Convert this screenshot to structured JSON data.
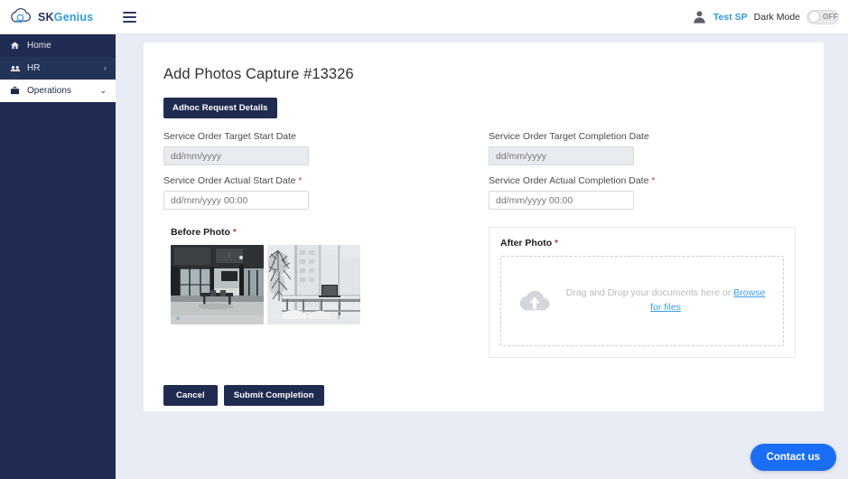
{
  "brand": {
    "sk": "SK",
    "genius": "Genius",
    "logo_icon": "cloud-icon"
  },
  "topbar": {
    "menu_icon": "hamburger-menu-icon",
    "avatar_icon": "user-avatar-icon",
    "user_name": "Test SP",
    "dark_mode_label": "Dark Mode",
    "toggle_state": "OFF",
    "accent_blue": "#2f9ae0"
  },
  "sidebar": {
    "bg_color": "#1f2b50",
    "items": [
      {
        "label": "Home",
        "icon": "home-icon",
        "chevron": "",
        "active": false
      },
      {
        "label": "HR",
        "icon": "people-icon",
        "chevron": "›",
        "active": false
      },
      {
        "label": "Operations",
        "icon": "briefcase-icon",
        "chevron": "⌄",
        "active": true
      }
    ]
  },
  "main": {
    "title": "Add Photos Capture #13326",
    "adhoc_button": "Adhoc Request Details",
    "fields": [
      {
        "label": "Service Order Target Start Date",
        "required": false,
        "value": "",
        "placeholder": "dd/mm/yyyy",
        "disabled": true
      },
      {
        "label": "Service Order Target Completion Date",
        "required": false,
        "value": "",
        "placeholder": "dd/mm/yyyy",
        "disabled": true
      },
      {
        "label": "Service Order Actual Start Date",
        "required": true,
        "value": "",
        "placeholder": "dd/mm/yyyy 00:00",
        "disabled": false
      },
      {
        "label": "Service Order Actual Completion Date",
        "required": true,
        "value": "",
        "placeholder": "dd/mm/yyyy 00:00",
        "disabled": false
      }
    ],
    "before_photo": {
      "label": "Before Photo",
      "required": true,
      "thumbs": [
        {
          "alt": "dark-industrial-office-interior"
        },
        {
          "alt": "bright-window-desk-with-laptop"
        }
      ]
    },
    "after_photo": {
      "label": "After Photo",
      "required": true,
      "dropzone_icon": "cloud-upload-icon",
      "dropzone_text": "Drag and Drop your documents here or ",
      "dropzone_link": "Browse for files",
      "link_color": "#3a9ee8"
    },
    "actions": {
      "cancel": "Cancel",
      "submit": "Submit Completion"
    }
  },
  "contact": {
    "label": "Contact us",
    "color": "#1a6ef5"
  },
  "required_marker": "*"
}
